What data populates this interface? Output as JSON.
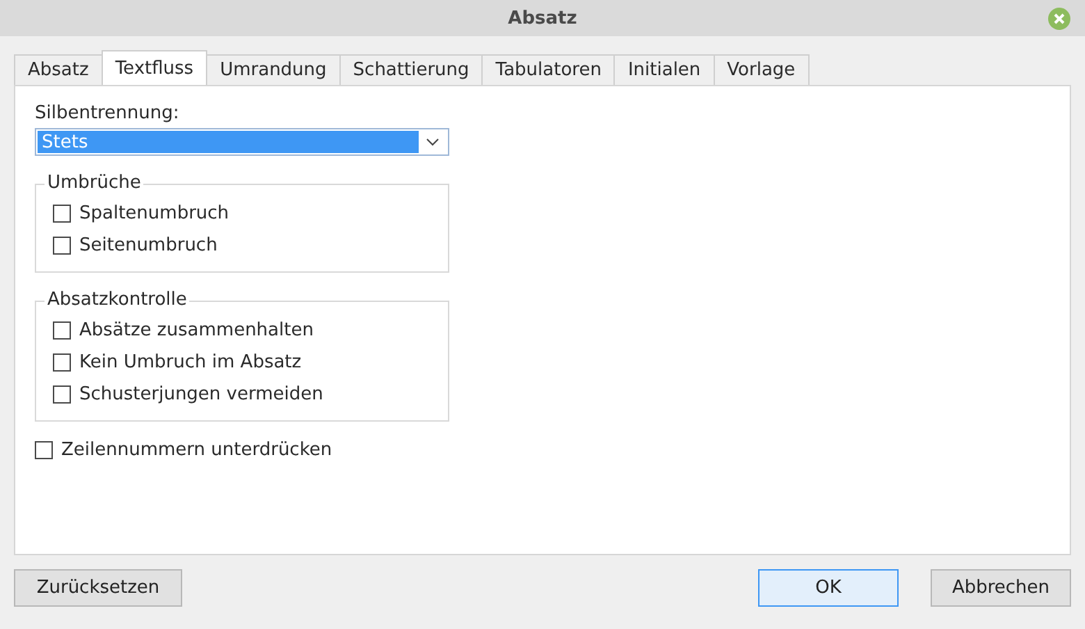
{
  "window": {
    "title": "Absatz"
  },
  "tabs": [
    {
      "label": "Absatz",
      "selected": false
    },
    {
      "label": "Textfluss",
      "selected": true
    },
    {
      "label": "Umrandung",
      "selected": false
    },
    {
      "label": "Schattierung",
      "selected": false
    },
    {
      "label": "Tabulatoren",
      "selected": false
    },
    {
      "label": "Initialen",
      "selected": false
    },
    {
      "label": "Vorlage",
      "selected": false
    }
  ],
  "hyphenation": {
    "label": "Silbentrennung:",
    "value": "Stets"
  },
  "groups": [
    {
      "title": "Umbrüche",
      "options": [
        {
          "label": "Spaltenumbruch",
          "checked": false
        },
        {
          "label": "Seitenumbruch",
          "checked": false
        }
      ]
    },
    {
      "title": "Absatzkontrolle",
      "options": [
        {
          "label": "Absätze zusammenhalten",
          "checked": false
        },
        {
          "label": "Kein Umbruch im Absatz",
          "checked": false
        },
        {
          "label": "Schusterjungen vermeiden",
          "checked": false
        }
      ]
    }
  ],
  "standalone": {
    "label": "Zeilennummern unterdrücken",
    "checked": false
  },
  "buttons": {
    "reset": "Zurücksetzen",
    "ok": "OK",
    "cancel": "Abbrechen"
  }
}
